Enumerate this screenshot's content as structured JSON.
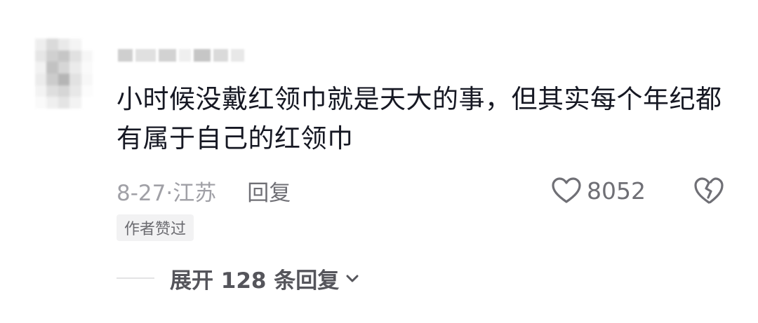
{
  "comment": {
    "text": "小时候没戴红领巾就是天大的事，但其实每个年纪都有属于自己的红领巾",
    "date_location": "8-27·江苏",
    "reply_label": "回复",
    "like_count": "8052",
    "author_liked_badge": "作者赞过",
    "expand_replies_label": "展开 128 条回复"
  },
  "icons": {
    "like": "heart-outline-icon",
    "dislike": "broken-heart-icon",
    "expand": "chevron-down-icon"
  },
  "colors": {
    "text_primary": "#161823",
    "text_secondary": "#9a9aa0",
    "icon_gray": "#6f6f75",
    "badge_bg": "#f2f2f3"
  }
}
